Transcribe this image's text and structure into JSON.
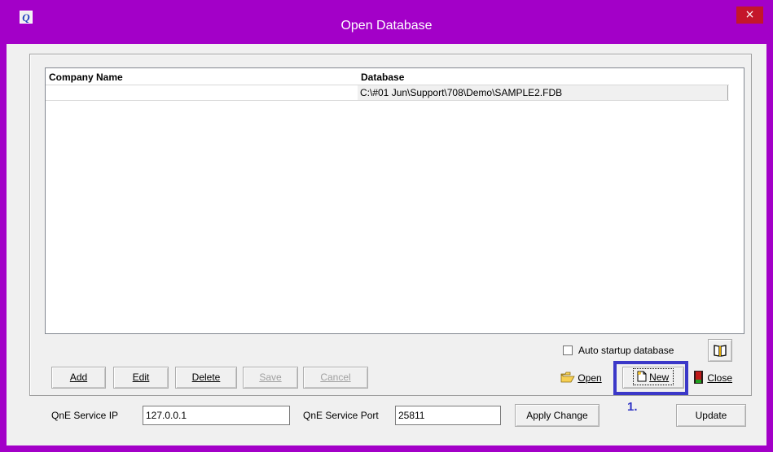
{
  "window": {
    "title": "Open Database",
    "close_glyph": "×",
    "app_icon_letter": "Q",
    "accent_color": "#a300c8",
    "close_color": "#c4162a"
  },
  "grid": {
    "columns": [
      "Company Name",
      "Database"
    ],
    "rows": [
      {
        "company_name": "",
        "database": "C:\\#01 Jun\\Support\\708\\Demo\\SAMPLE2.FDB"
      }
    ]
  },
  "options": {
    "auto_startup_label": "Auto startup database",
    "auto_startup_checked": false
  },
  "buttons": {
    "add": "Add",
    "edit": "Edit",
    "delete": "Delete",
    "save": "Save",
    "cancel": "Cancel",
    "open": "Open",
    "new": "New",
    "close": "Close",
    "apply_change": "Apply Change",
    "update": "Update"
  },
  "icons": {
    "book": "book-icon",
    "folder_open": "folder-open-icon",
    "new_document": "new-document-icon",
    "exit_door": "exit-door-icon"
  },
  "annotation": {
    "marker": "1.",
    "highlight_color": "#3b38c8"
  },
  "service": {
    "ip_label": "QnE Service IP",
    "ip_value": "127.0.0.1",
    "port_label": "QnE Service Port",
    "port_value": "25811"
  }
}
